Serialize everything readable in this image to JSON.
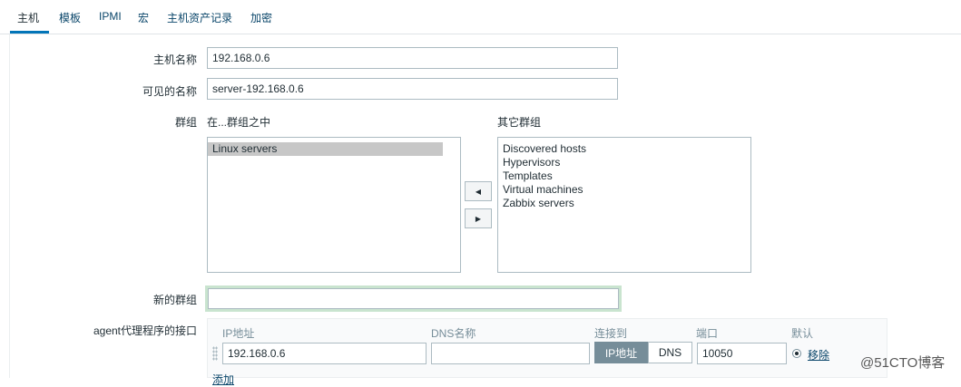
{
  "tabs": [
    {
      "label": "主机",
      "active": true
    },
    {
      "label": "模板",
      "active": false
    },
    {
      "label": "IPMI",
      "active": false
    },
    {
      "label": "宏",
      "active": false
    },
    {
      "label": "主机资产记录",
      "active": false
    },
    {
      "label": "加密",
      "active": false
    }
  ],
  "form": {
    "host_name_label": "主机名称",
    "host_name_value": "192.168.0.6",
    "visible_name_label": "可见的名称",
    "visible_name_value": "server-192.168.0.6",
    "groups_label": "群组",
    "in_groups_label": "在...群组之中",
    "other_groups_label": "其它群组",
    "in_groups": [
      "Linux servers"
    ],
    "other_groups": [
      "Discovered hosts",
      "Hypervisors",
      "Templates",
      "Virtual machines",
      "Zabbix servers"
    ],
    "move_left_icon": "◀",
    "move_right_icon": "▶",
    "new_group_label": "新的群组",
    "new_group_value": "",
    "agent_interfaces_label": "agent代理程序的接口"
  },
  "interface": {
    "col_ip": "IP地址",
    "col_dns": "DNS名称",
    "col_connect": "连接到",
    "col_port": "端口",
    "col_default": "默认",
    "ip_value": "192.168.0.6",
    "dns_value": "",
    "connect_ip": "IP地址",
    "connect_dns": "DNS",
    "port_value": "10050",
    "remove_link": "移除",
    "add_link": "添加"
  },
  "watermark": "@51CTO博客",
  "colors": {
    "accent": "#0275b8",
    "active_seg": "#768d99",
    "focus_outline": "#c9e4cf"
  }
}
